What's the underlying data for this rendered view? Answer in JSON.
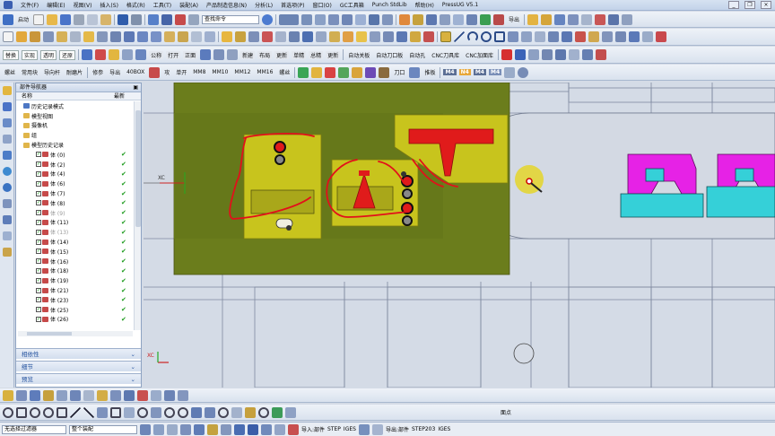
{
  "menu": {
    "items": [
      "文件(F)",
      "编辑(E)",
      "视图(V)",
      "插入(S)",
      "格式(R)",
      "工具(T)",
      "装配(A)",
      "产品制造信息(N)",
      "分析(L)",
      "首选项(P)",
      "窗口(O)",
      "GC工具箱",
      "Punch StdLib",
      "帮助(H)",
      "PressUG V5.1"
    ]
  },
  "toolbar1": {
    "start_label": "启动",
    "command_search_placeholder": "查找命令",
    "export_label": "导出"
  },
  "toolbar3": {
    "labels": [
      "替换",
      "实现",
      "透明",
      "还原",
      "公称",
      "打开",
      "正面",
      "新建",
      "布局",
      "更新",
      "单精",
      "总精",
      "更新",
      "自动关板",
      "自动刀口板",
      "自动孔",
      "CNC刀具库",
      "CNC加面库"
    ]
  },
  "toolbar4": {
    "labels": [
      "螺丝",
      "常用块",
      "导向杆",
      "耐磨片",
      "修参",
      "导出",
      "40BOX",
      "攻",
      "单开",
      "MM8",
      "MM10",
      "MM12",
      "MM16",
      "螺丝",
      "刀口",
      "推板"
    ],
    "m_labels": [
      "M4",
      "N4",
      "M4",
      "M4"
    ]
  },
  "navigator": {
    "title": "部件导航器",
    "col_name": "名称",
    "col_latest": "最新",
    "rows": [
      {
        "label": "历史记录模式",
        "kind": "mode"
      },
      {
        "label": "模型视图",
        "kind": "folder"
      },
      {
        "label": "摄像机",
        "kind": "folder"
      },
      {
        "label": "组",
        "kind": "folder"
      },
      {
        "label": "模型历史记录",
        "kind": "folder"
      },
      {
        "label": "体 (0)",
        "tick": true
      },
      {
        "label": "体 (2)",
        "tick": true
      },
      {
        "label": "体 (4)",
        "tick": true
      },
      {
        "label": "体 (6)",
        "tick": true
      },
      {
        "label": "体 (7)",
        "tick": true
      },
      {
        "label": "体 (8)",
        "tick": true
      },
      {
        "label": "体 (9)",
        "tick": true,
        "grey": true
      },
      {
        "label": "体 (11)",
        "tick": true
      },
      {
        "label": "体 (13)",
        "tick": true,
        "grey": true
      },
      {
        "label": "体 (14)",
        "tick": true
      },
      {
        "label": "体 (15)",
        "tick": true
      },
      {
        "label": "体 (16)",
        "tick": true
      },
      {
        "label": "体 (18)",
        "tick": true
      },
      {
        "label": "体 (19)",
        "tick": true
      },
      {
        "label": "体 (21)",
        "tick": true
      },
      {
        "label": "体 (23)",
        "tick": true
      },
      {
        "label": "体 (25)",
        "tick": true
      },
      {
        "label": "体 (26)",
        "tick": true
      }
    ],
    "panels": [
      "相依性",
      "细节",
      "预览"
    ]
  },
  "viewport": {
    "axis_label_top": "XC",
    "axis_label_bottom": "XC"
  },
  "statusbar": {
    "filter_value": "无选择过滤器",
    "scope_value": "整个装配",
    "import_labels": [
      "导入:部件",
      "STEP",
      "IGES"
    ],
    "export_labels": [
      "导出:部件",
      "STEP203",
      "IGES"
    ],
    "face_label": "面点"
  },
  "colors": {
    "plate_green": "#6b7d1c",
    "yellow_insert": "#c8c41d",
    "red_part": "#e01b1b",
    "magenta_part": "#e622e6",
    "cyan_part": "#35d0d8",
    "annotation_red": "#e2101a"
  }
}
